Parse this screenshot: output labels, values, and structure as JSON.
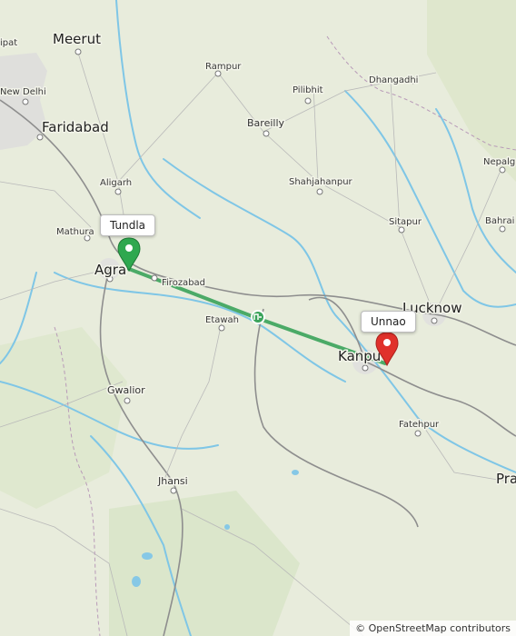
{
  "map": {
    "attribution": "© OpenStreetMap contributors",
    "route_color": "#3aa35a",
    "origin_marker_color": "#2fa84f",
    "destination_marker_color": "#e0312b",
    "river_color": "#7fc6e6",
    "background_color": "#e6ead9"
  },
  "markers": {
    "origin": {
      "label": "Tundla",
      "icon": "map-pin-icon"
    },
    "destination": {
      "label": "Unnao",
      "icon": "map-pin-icon"
    },
    "midpoint": {
      "icon": "route-midpoint-icon"
    }
  },
  "places": {
    "ipat": "ipat",
    "meerut": "Meerut",
    "new_delhi": "New Delhi",
    "faridabad": "Faridabad",
    "rampur": "Rampur",
    "pilibhit": "Pilibhit",
    "dhangadhi": "Dhangadhi",
    "bareilly": "Bareilly",
    "aligarh": "Aligarh",
    "shahjahanpur": "Shahjahanpur",
    "nepalg": "Nepalg",
    "mathura": "Mathura",
    "sitapur": "Sitapur",
    "bahrai": "Bahrai",
    "agra": "Agra",
    "firozabad": "Firozabad",
    "lucknow": "Lucknow",
    "etawah": "Etawah",
    "kanpur": "Kanpu",
    "gwalior": "Gwalior",
    "fatehpur": "Fatehpur",
    "jhansi": "Jhansi",
    "pra": "Pra"
  }
}
